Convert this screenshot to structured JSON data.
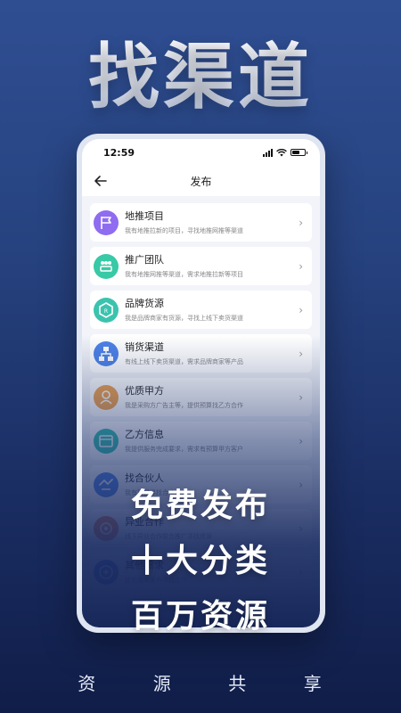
{
  "hero": {
    "title": "找渠道"
  },
  "phone": {
    "status_bar": {
      "time": "12:59"
    },
    "nav": {
      "title": "发布"
    },
    "items": [
      {
        "title": "地推项目",
        "desc": "我有地推拉新的项目，寻找地推网推等渠道",
        "icon": "flag-icon",
        "color": "#8f6cf0"
      },
      {
        "title": "推广团队",
        "desc": "我有地推网推等渠道，需求地推拉新等项目",
        "icon": "team-icon",
        "color": "#38c9a6"
      },
      {
        "title": "品牌货源",
        "desc": "我是品牌商家有货源，寻找上线下卖货渠道",
        "icon": "brand-icon",
        "color": "#3bc3ae"
      },
      {
        "title": "销货渠道",
        "desc": "有线上线下卖货渠道，需求品牌商家等产品",
        "icon": "channel-icon",
        "color": "#4d82e8"
      },
      {
        "title": "优质甲方",
        "desc": "我是采购方广告主等，提供预算找乙方合作",
        "icon": "client-icon",
        "color": "#f0a14a"
      },
      {
        "title": "乙方信息",
        "desc": "我提供服务完成要求，需求有预算甲方客户",
        "icon": "vendor-icon",
        "color": "#2fbfad"
      },
      {
        "title": "找合伙人",
        "desc": "我有项目寻找合伙人",
        "icon": "partner-icon",
        "color": "#4d82e8"
      },
      {
        "title": "异业合作",
        "desc": "线下异业合作联合推广寻找资源",
        "icon": "cooperation-icon",
        "color": "#f07a4a"
      },
      {
        "title": "其他需求",
        "desc": "其他需求发布寻找合作",
        "icon": "other-icon",
        "color": "#4d6fe8"
      }
    ]
  },
  "taglines": [
    "免费发布",
    "十大分类",
    "百万资源"
  ],
  "footer": [
    "资",
    "源",
    "共",
    "享"
  ]
}
